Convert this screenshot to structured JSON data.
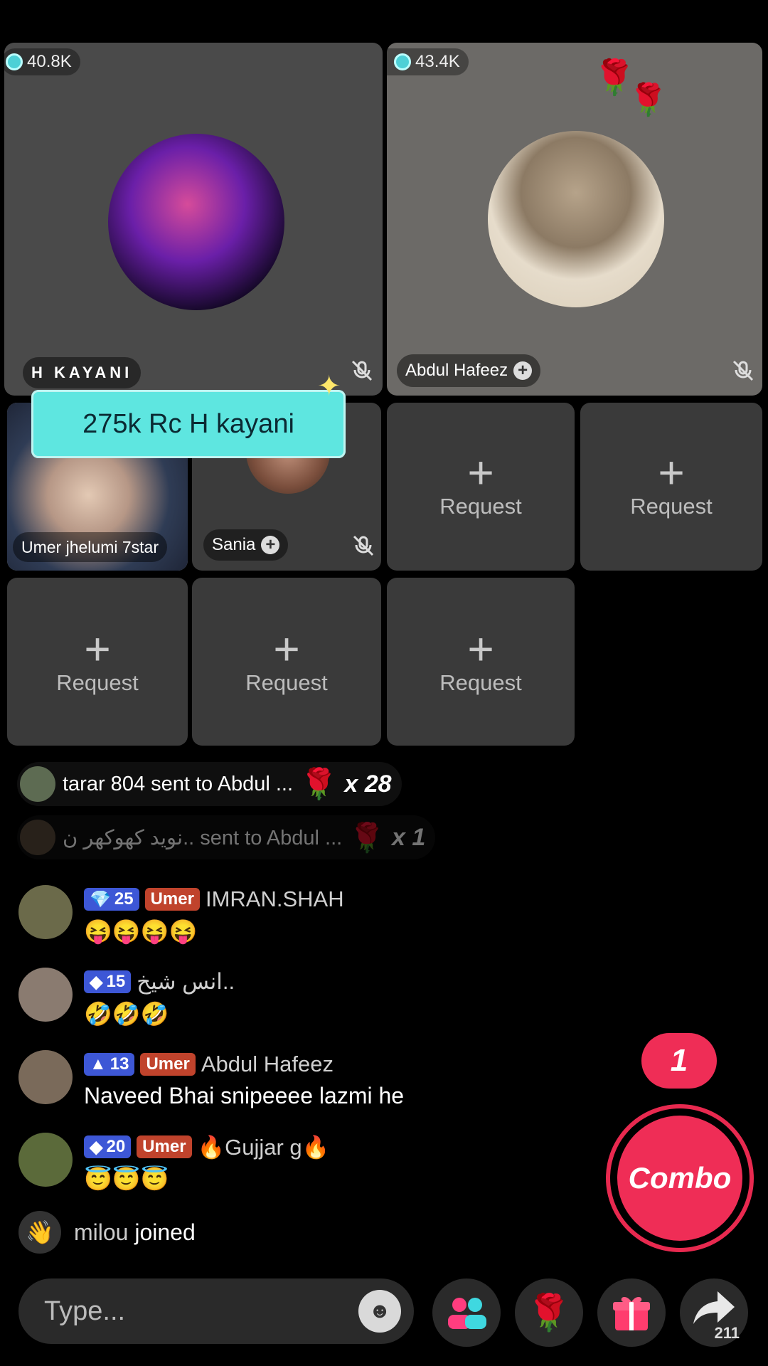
{
  "hosts": [
    {
      "viewers": "40.8K",
      "name": "H KAYANI"
    },
    {
      "viewers": "43.4K",
      "name": "Abdul Hafeez"
    }
  ],
  "guests": [
    {
      "name": "Umer jhelumi 7star"
    },
    {
      "name": "Sania"
    }
  ],
  "banner_text": "275k Rc H kayani",
  "request_label": "Request",
  "gifts": [
    {
      "text": "tarar 804 sent to Abdul ...",
      "count": "x 28"
    },
    {
      "text": "نوید کھوکھر ن.. sent to Abdul ...",
      "count": "x 1"
    }
  ],
  "chat": [
    {
      "level": "25",
      "fan": "Umer",
      "user": "IMRAN.SHAH",
      "message": "😝😝😝😝"
    },
    {
      "level": "15",
      "fan": "",
      "user": "انس شیخ..",
      "message": "🤣🤣🤣"
    },
    {
      "level": "13",
      "fan": "Umer",
      "user": "Abdul Hafeez",
      "message": "Naveed Bhai snipeeee lazmi he"
    },
    {
      "level": "20",
      "fan": "Umer",
      "user": "🔥Gujjar g🔥",
      "message": "😇😇😇"
    }
  ],
  "joined": {
    "user": "milou",
    "text": "joined"
  },
  "input_placeholder": "Type...",
  "combo": {
    "count": "1",
    "label": "Combo"
  },
  "share_count": "211",
  "colors": {
    "accent": "#ef2d56",
    "banner": "#5ee6e0",
    "level_badge": "#3d57d6"
  }
}
